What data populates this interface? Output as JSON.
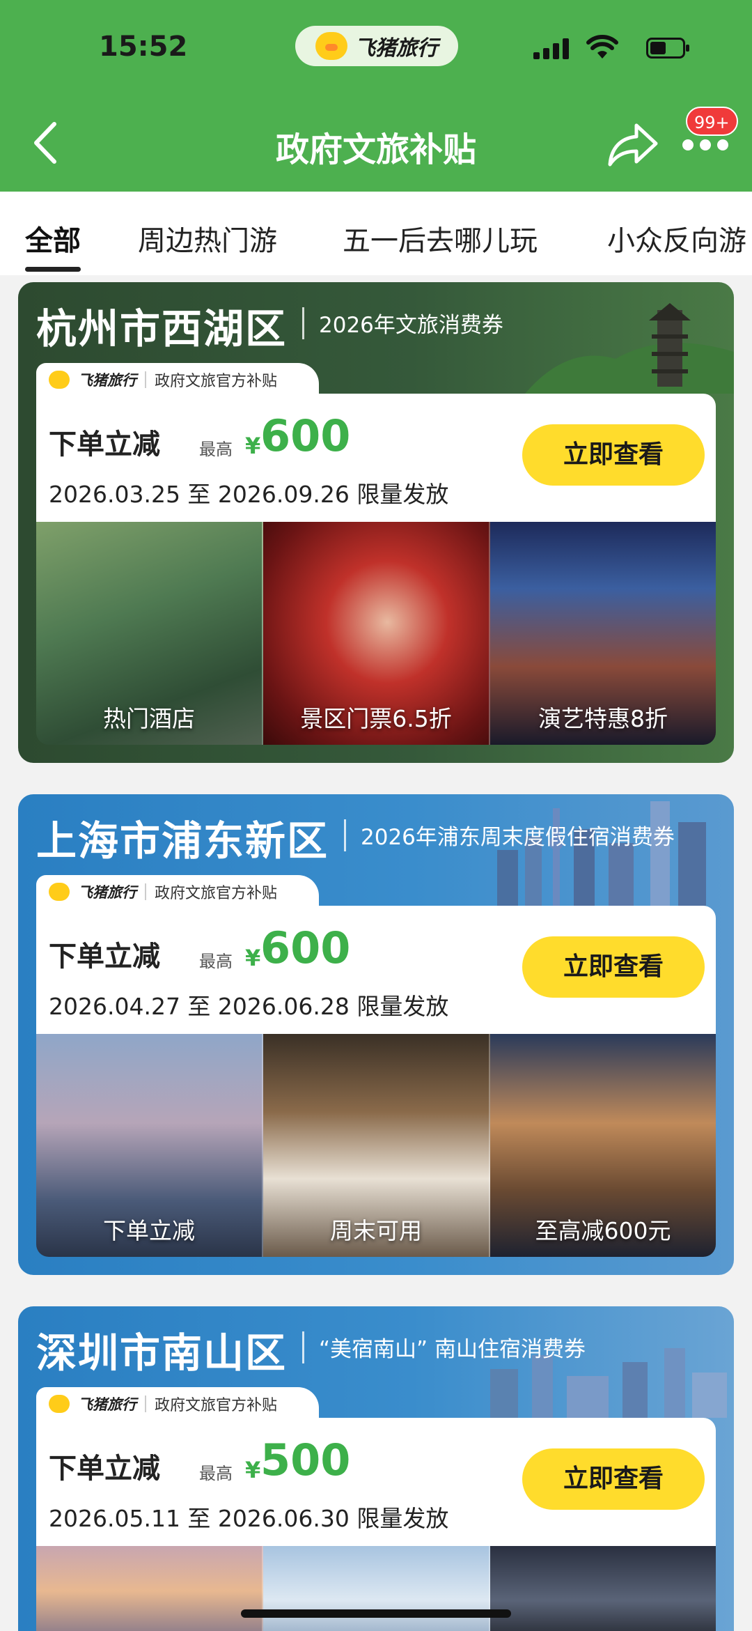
{
  "status_bar": {
    "time": "15:52",
    "app_pill": "飞猪旅行"
  },
  "nav": {
    "title": "政府文旅补贴",
    "badge": "99+"
  },
  "tabs": [
    "全部",
    "周边热门游",
    "五一后去哪儿玩",
    "小众反向游"
  ],
  "cards": [
    {
      "city": "杭州市西湖区",
      "voucher": "2026年文旅消费券",
      "tag_brand": "飞猪旅行",
      "tag_text": "政府文旅官方补贴",
      "deal_label": "下单立减",
      "max_label": "最高",
      "currency": "¥",
      "amount": "600",
      "dates": "2026.03.25 至 2026.09.26 限量发放",
      "button": "立即查看",
      "photos": [
        "热门酒店",
        "景区门票6.5折",
        "演艺特惠8折"
      ],
      "colors": {
        "theme": "#2f5a35"
      }
    },
    {
      "city": "上海市浦东新区",
      "voucher": "2026年浦东周末度假住宿消费券",
      "tag_brand": "飞猪旅行",
      "tag_text": "政府文旅官方补贴",
      "deal_label": "下单立减",
      "max_label": "最高",
      "currency": "¥",
      "amount": "600",
      "dates": "2026.04.27 至 2026.06.28 限量发放",
      "button": "立即查看",
      "photos": [
        "下单立减",
        "周末可用",
        "至高减600元"
      ],
      "colors": {
        "theme": "#2f86c6"
      }
    },
    {
      "city": "深圳市南山区",
      "voucher": "“美宿南山” 南山住宿消费券",
      "tag_brand": "飞猪旅行",
      "tag_text": "政府文旅官方补贴",
      "deal_label": "下单立减",
      "max_label": "最高",
      "currency": "¥",
      "amount": "500",
      "dates": "2026.05.11 至 2026.06.30 限量发放",
      "button": "立即查看",
      "photos": [
        "",
        "",
        ""
      ],
      "colors": {
        "theme": "#2f86c6"
      }
    }
  ],
  "colors": {
    "header_bg": "#4db04f",
    "accent_green": "#3db04a",
    "button_yellow": "#ffdc2c"
  }
}
